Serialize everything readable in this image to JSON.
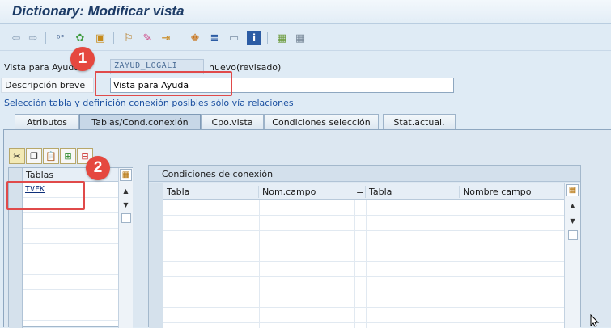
{
  "window": {
    "title": "Dictionary: Modificar vista"
  },
  "toolbar": {
    "icons": [
      "back-arrow-icon",
      "forward-arrow-icon",
      "display-change-icon",
      "other-object-icon",
      "activate-icon",
      "where-used-icon",
      "magic-wand-icon",
      "navigate-icon",
      "hierarchy-icon",
      "list-icon",
      "frame-icon",
      "info-icon",
      "table-icon",
      "grid-icon"
    ]
  },
  "form": {
    "view_label": "Vista para Ayuda",
    "view_value": "ZAYUD_LOGALI",
    "view_status": "nuevo(revisado)",
    "short_desc_label": "Descripción breve",
    "short_desc_value": "Vista para Ayuda",
    "relations_note": "Selección tabla y definición conexión posibles sólo vía relaciones"
  },
  "tabs": [
    {
      "label": "Atributos",
      "active": false
    },
    {
      "label": "Tablas/Cond.conexión",
      "active": true
    },
    {
      "label": "Cpo.vista",
      "active": false
    },
    {
      "label": "Condiciones selección",
      "active": false
    },
    {
      "label": "Stat.actual.",
      "active": false
    }
  ],
  "tables_grid": {
    "header": "Tablas",
    "rows": [
      "TVFK"
    ]
  },
  "join_conditions": {
    "title": "Condiciones de conexión",
    "columns": [
      "Tabla",
      "Nom.campo",
      "=",
      "Tabla",
      "Nombre campo"
    ]
  },
  "annotations": {
    "badge1": "1",
    "badge2": "2"
  },
  "colors": {
    "accent": "#1c3b66",
    "highlight": "#e04a4a",
    "link": "#1a4fa0"
  }
}
